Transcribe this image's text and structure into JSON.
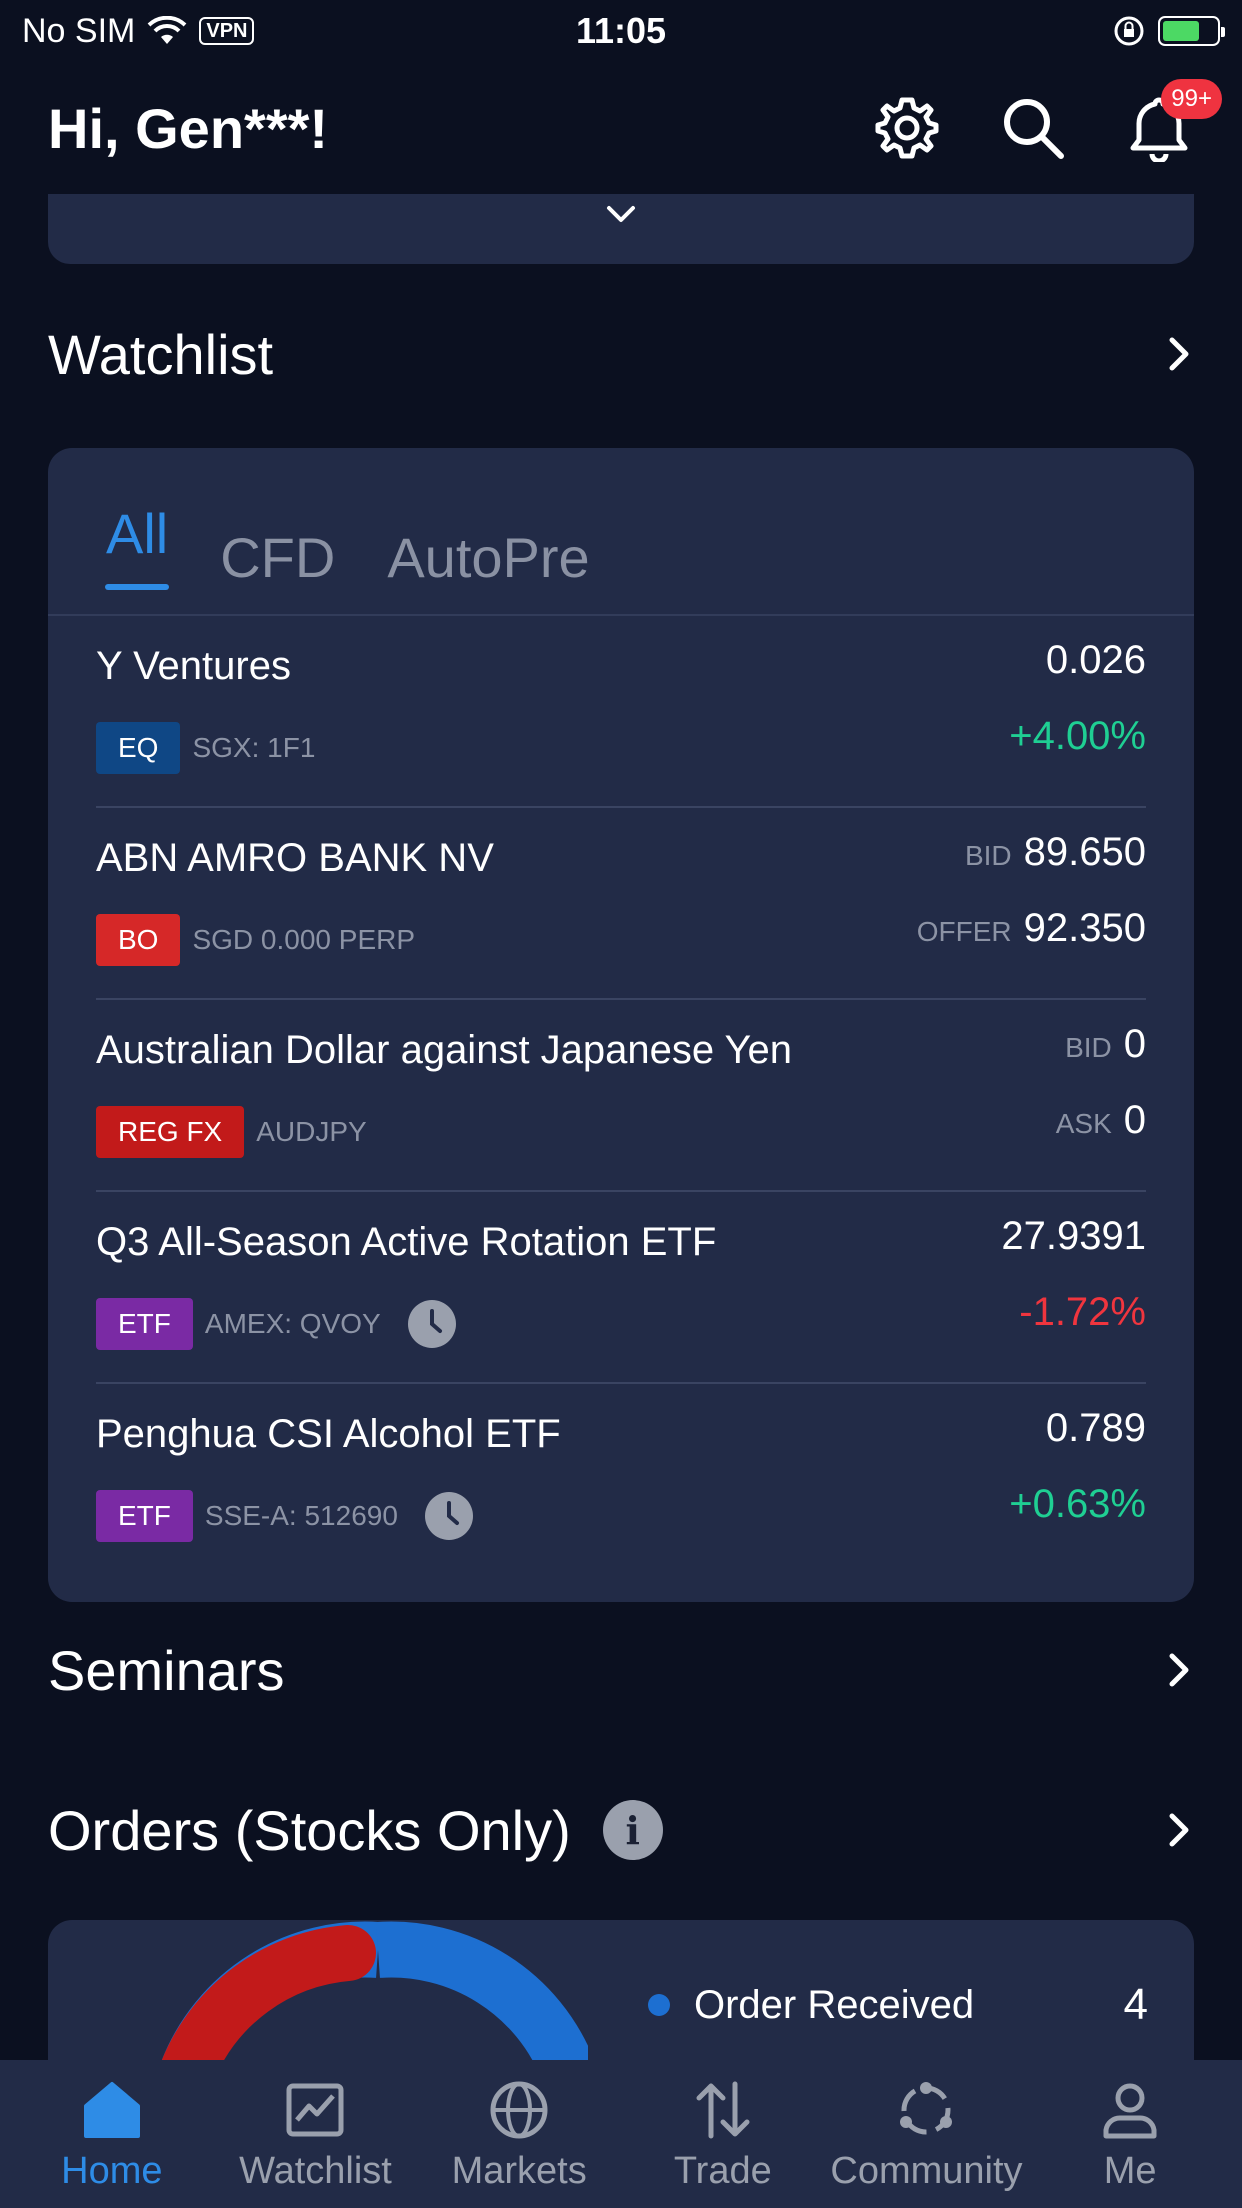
{
  "status_bar": {
    "carrier": "No SIM",
    "vpn": "VPN",
    "time": "11:05"
  },
  "header": {
    "greeting": "Hi, Gen***!",
    "notification_badge": "99+"
  },
  "watchlist": {
    "title": "Watchlist",
    "tabs": [
      {
        "label": "All",
        "active": true
      },
      {
        "label": "CFD",
        "active": false
      },
      {
        "label": "AutoPre",
        "active": false
      }
    ],
    "rows": [
      {
        "name": "Y Ventures",
        "tag": "EQ",
        "code": "SGX: 1F1",
        "price": "0.026",
        "change": "+4.00%"
      },
      {
        "name": "ABN AMRO BANK NV",
        "tag": "BO",
        "code": "SGD 0.000 PERP",
        "bid_label": "BID",
        "bid": "89.650",
        "offer_label": "OFFER",
        "offer": "92.350"
      },
      {
        "name": "Australian Dollar against Japanese Yen",
        "tag": "REG FX",
        "code": "AUDJPY",
        "bid_label": "BID",
        "bid": "0",
        "ask_label": "ASK",
        "ask": "0"
      },
      {
        "name": "Q3 All-Season Active Rotation ETF",
        "tag": "ETF",
        "code": "AMEX: QVOY",
        "price": "27.9391",
        "change": "-1.72%"
      },
      {
        "name": "Penghua CSI Alcohol ETF",
        "tag": "ETF",
        "code": "SSE-A: 512690",
        "price": "0.789",
        "change": "+0.63%"
      }
    ]
  },
  "seminars": {
    "title": "Seminars"
  },
  "orders": {
    "title": "Orders (Stocks Only)",
    "info_icon": "i",
    "legend": [
      {
        "label": "Order Received",
        "count": "4",
        "color": "#1d6fd1"
      }
    ],
    "donut_colors": [
      "#c21a1a",
      "#1d6fd1"
    ]
  },
  "tab_bar": {
    "items": [
      {
        "label": "Home",
        "icon": "home-icon",
        "active": true
      },
      {
        "label": "Watchlist",
        "icon": "chart-icon",
        "active": false
      },
      {
        "label": "Markets",
        "icon": "globe-icon",
        "active": false
      },
      {
        "label": "Trade",
        "icon": "trade-arrows-icon",
        "active": false
      },
      {
        "label": "Community",
        "icon": "community-icon",
        "active": false
      },
      {
        "label": "Me",
        "icon": "person-icon",
        "active": false
      }
    ]
  },
  "colors": {
    "background": "#0b1020",
    "card": "#222b47",
    "accent": "#2e8ce6",
    "positive": "#1fcf93",
    "negative": "#f0353e"
  }
}
